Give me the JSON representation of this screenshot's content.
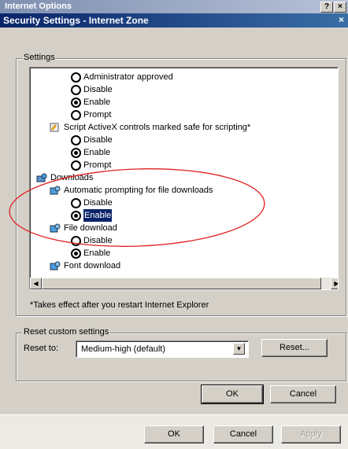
{
  "outer_window": {
    "title": "Internet Options",
    "help_button": "?",
    "close_button": "×"
  },
  "dialog": {
    "title": "Security Settings - Internet Zone",
    "close_button": "×"
  },
  "settings_group": {
    "label": "Settings",
    "items": [
      {
        "type": "radio",
        "label": "Administrator approved",
        "selected": false
      },
      {
        "type": "radio",
        "label": "Disable",
        "selected": false
      },
      {
        "type": "radio",
        "label": "Enable",
        "selected": true
      },
      {
        "type": "radio",
        "label": "Prompt",
        "selected": false
      },
      {
        "type": "category",
        "label": "Script ActiveX controls marked safe for scripting*"
      },
      {
        "type": "radio",
        "label": "Disable",
        "selected": false
      },
      {
        "type": "radio",
        "label": "Enable",
        "selected": true
      },
      {
        "type": "radio",
        "label": "Prompt",
        "selected": false
      },
      {
        "type": "section",
        "label": "Downloads"
      },
      {
        "type": "category",
        "label": "Automatic prompting for file downloads"
      },
      {
        "type": "radio",
        "label": "Disable",
        "selected": false
      },
      {
        "type": "radio",
        "label": "Enable",
        "selected": true,
        "highlighted": true
      },
      {
        "type": "category",
        "label": "File download"
      },
      {
        "type": "radio",
        "label": "Disable",
        "selected": false
      },
      {
        "type": "radio",
        "label": "Enable",
        "selected": true
      },
      {
        "type": "category",
        "label": "Font download"
      }
    ],
    "footnote": "*Takes effect after you restart Internet Explorer"
  },
  "reset_group": {
    "label": "Reset custom settings",
    "reset_to_label": "Reset to:",
    "selected_level": "Medium-high (default)",
    "reset_button": "Reset..."
  },
  "dialog_buttons": {
    "ok": "OK",
    "cancel": "Cancel"
  },
  "outer_buttons": {
    "ok": "OK",
    "cancel": "Cancel",
    "apply": "Apply"
  },
  "annotation": {
    "shape": "ellipse",
    "color": "#e02020"
  }
}
